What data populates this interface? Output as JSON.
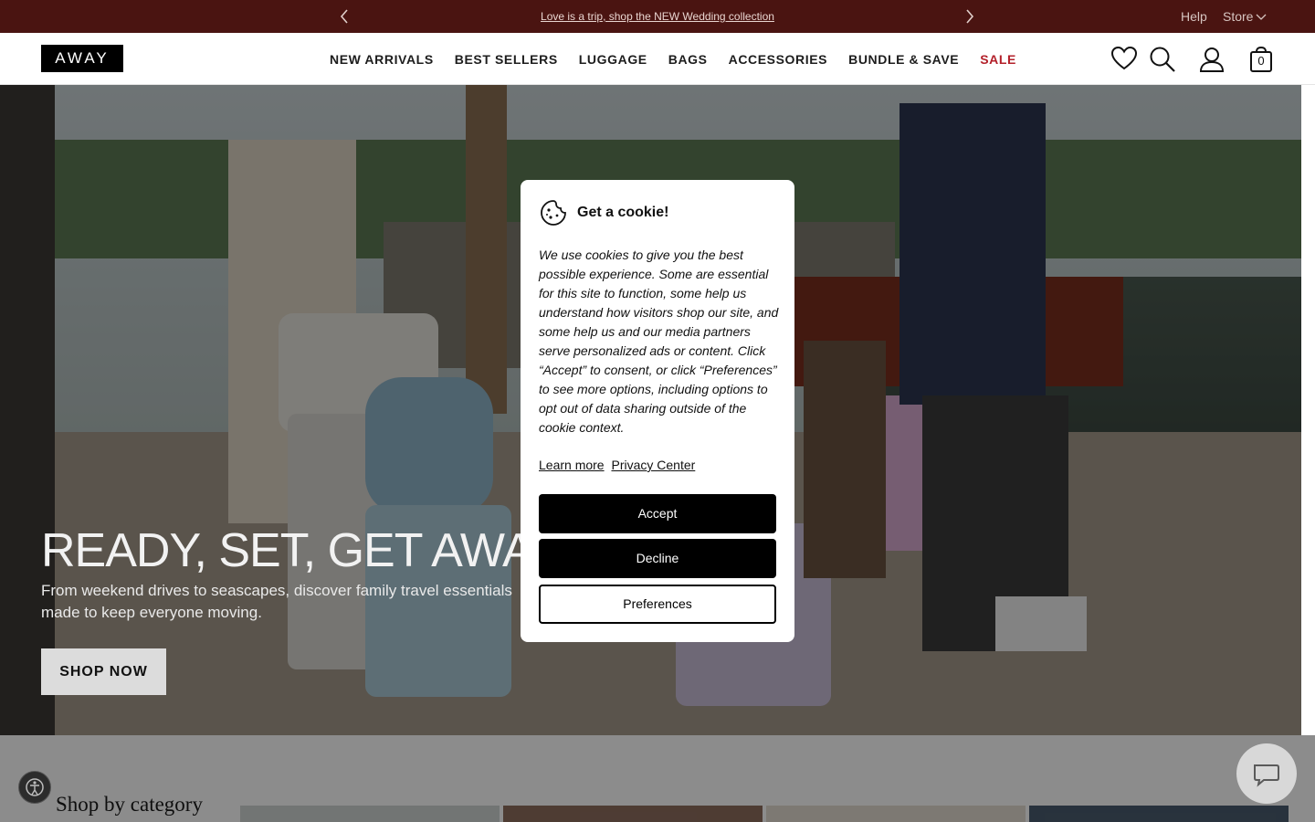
{
  "announcement": {
    "promo_text": "Love is a trip, shop the NEW Wedding collection",
    "help_label": "Help",
    "store_label": "Store"
  },
  "header": {
    "logo_text": "AWAY",
    "nav": [
      "NEW ARRIVALS",
      "BEST SELLERS",
      "LUGGAGE",
      "BAGS",
      "ACCESSORIES",
      "BUNDLE & SAVE",
      "SALE"
    ],
    "bag_count": "0",
    "sale_color": "#b3202a"
  },
  "hero": {
    "title": "READY, SET, GET AWAY",
    "subtitle": "From weekend drives to seascapes, discover family travel essentials made to keep everyone moving.",
    "cta_label": "SHOP NOW"
  },
  "section": {
    "shop_by_category": "Shop by category"
  },
  "cookie_modal": {
    "title": "Get a cookie!",
    "body": "We use cookies to give you the best possible experience. Some are essential for this site to function, some help us understand how visitors shop our site, and some help us and our media partners serve personalized ads or content. Click “Accept” to consent, or click “Preferences” to see more options, including options to opt out of data sharing outside of the cookie context.",
    "learn_more": "Learn more",
    "privacy_center": "Privacy Center",
    "accept_label": "Accept",
    "decline_label": "Decline",
    "preferences_label": "Preferences"
  },
  "colors": {
    "announcement_bg": "#4a1411",
    "button_dark": "#000000"
  }
}
